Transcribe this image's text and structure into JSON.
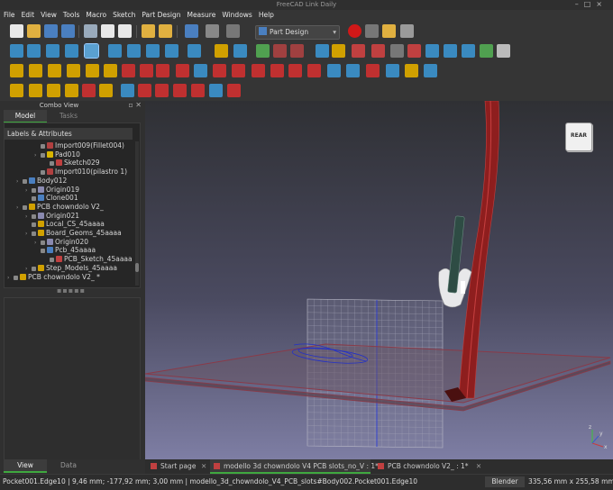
{
  "window": {
    "title": "FreeCAD Link Daily"
  },
  "menu": [
    "File",
    "Edit",
    "View",
    "Tools",
    "Macro",
    "Sketch",
    "Part Design",
    "Measure",
    "Windows",
    "Help"
  ],
  "toolbar": {
    "workbench": "Part Design"
  },
  "combo": {
    "title": "Combo View",
    "tab_model": "Model",
    "tab_tasks": "Tasks",
    "tree_header": "Labels & Attributes"
  },
  "tree": [
    {
      "label": "Import009(Fillet004)",
      "indent": 3,
      "icon_color": "#b04040",
      "has_arrow": false
    },
    {
      "label": "Pad010",
      "indent": 3,
      "icon_color": "#d8b400",
      "has_arrow": true
    },
    {
      "label": "Sketch029",
      "indent": 4,
      "icon_color": "#c04040",
      "has_arrow": false
    },
    {
      "label": "Import010(pilastro 1)",
      "indent": 3,
      "icon_color": "#b04040",
      "has_arrow": false
    },
    {
      "label": "Body012",
      "indent": 1,
      "icon_color": "#4a7fc0",
      "has_arrow": true
    },
    {
      "label": "Origin019",
      "indent": 2,
      "icon_color": "#8a8ab0",
      "has_arrow": true
    },
    {
      "label": "Clone001",
      "indent": 2,
      "icon_color": "#4a7fc0",
      "has_arrow": false
    },
    {
      "label": "PCB chowndolo V2_",
      "indent": 1,
      "icon_color": "#d0a000",
      "has_arrow": true
    },
    {
      "label": "Origin021",
      "indent": 2,
      "icon_color": "#8a8ab0",
      "has_arrow": true
    },
    {
      "label": "Local_CS_45aaaa",
      "indent": 2,
      "icon_color": "#d0a000",
      "has_arrow": false
    },
    {
      "label": "Board_Geoms_45aaaa",
      "indent": 2,
      "icon_color": "#d0a000",
      "has_arrow": true
    },
    {
      "label": "Origin020",
      "indent": 3,
      "icon_color": "#8a8ab0",
      "has_arrow": true
    },
    {
      "label": "Pcb_45aaaa",
      "indent": 3,
      "icon_color": "#4a7fc0",
      "has_arrow": false
    },
    {
      "label": "PCB_Sketch_45aaaa",
      "indent": 4,
      "icon_color": "#c04040",
      "has_arrow": false
    },
    {
      "label": "Step_Models_45aaaa",
      "indent": 2,
      "icon_color": "#d0a000",
      "has_arrow": true
    },
    {
      "label": "PCB chowndolo V2_ *",
      "indent": 0,
      "icon_color": "#d0a000",
      "has_arrow": true
    }
  ],
  "bottom_tabs": {
    "view": "View",
    "data": "Data"
  },
  "navcube": {
    "face": "REAR"
  },
  "doc_tabs": [
    {
      "label": "Start page",
      "active": false
    },
    {
      "label": "modello 3d chowndolo V4 PCB slots_no_V : 1*",
      "active": true
    },
    {
      "label": "PCB chowndolo V2_ : 1*",
      "active": false
    }
  ],
  "status": {
    "message": "Pocket001.Edge10 | 9,46 mm; -177,92 mm; 3,00 mm | modello_3d_chowndolo_V4_PCB_slots#Body002.Pocket001.Edge10",
    "nav_style": "Blender",
    "dimensions": "335,56 mm x 255,58 mm"
  }
}
